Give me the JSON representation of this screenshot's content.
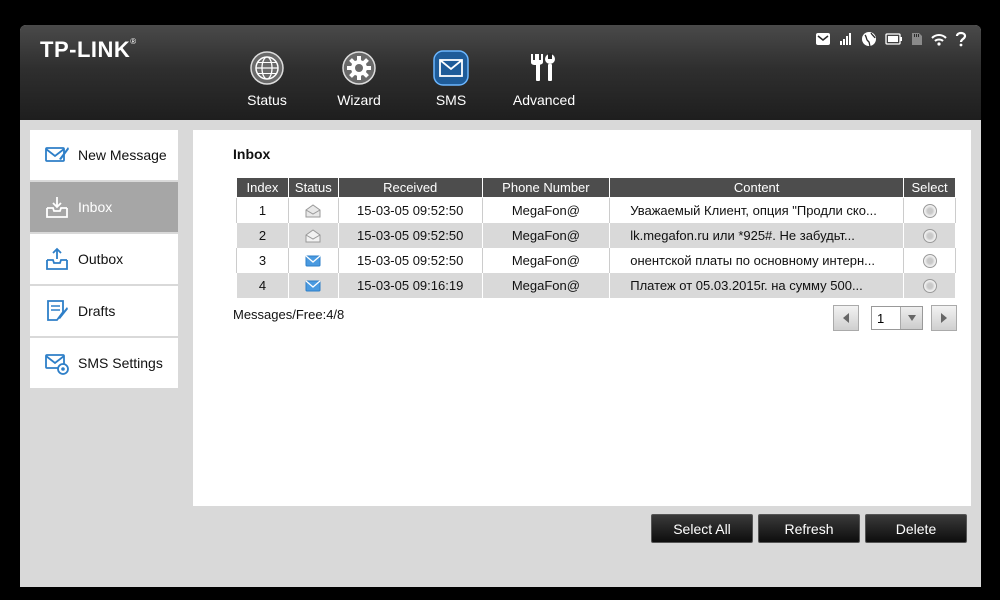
{
  "brand": {
    "logo_text": "TP-LINK",
    "logo_mark": "®"
  },
  "nav": [
    {
      "label": "Status",
      "icon": "globe-icon"
    },
    {
      "label": "Wizard",
      "icon": "gear-icon"
    },
    {
      "label": "SMS",
      "icon": "envelope-icon",
      "active": true
    },
    {
      "label": "Advanced",
      "icon": "tools-icon"
    }
  ],
  "status_bar": [
    "sms-icon",
    "signal-icon",
    "internet-icon",
    "battery-icon",
    "sd-card-icon",
    "wifi-icon",
    "help-icon"
  ],
  "sidebar": {
    "items": [
      {
        "label": "New Message",
        "icon": "new-message-icon"
      },
      {
        "label": "Inbox",
        "icon": "inbox-icon",
        "active": true
      },
      {
        "label": "Outbox",
        "icon": "outbox-icon"
      },
      {
        "label": "Drafts",
        "icon": "drafts-icon"
      },
      {
        "label": "SMS Settings",
        "icon": "sms-settings-icon"
      }
    ]
  },
  "inbox": {
    "title": "Inbox",
    "columns": [
      "Index",
      "Status",
      "Received",
      "Phone Number",
      "Content",
      "Select"
    ],
    "rows": [
      {
        "index": "1",
        "status": "read",
        "received": "15-03-05 09:52:50",
        "phone": "MegaFon@",
        "content": "Уважаемый Клиент, опция \"Продли ско..."
      },
      {
        "index": "2",
        "status": "read",
        "received": "15-03-05 09:52:50",
        "phone": "MegaFon@",
        "content": "lk.megafon.ru или *925#. Не забудьт..."
      },
      {
        "index": "3",
        "status": "unread",
        "received": "15-03-05 09:52:50",
        "phone": "MegaFon@",
        "content": "онентской платы по основному интерн..."
      },
      {
        "index": "4",
        "status": "unread",
        "received": "15-03-05 09:16:19",
        "phone": "MegaFon@",
        "content": "Платеж от 05.03.2015г. на сумму 500..."
      }
    ],
    "message_count": "Messages/Free:4/8",
    "page": "1"
  },
  "actions": {
    "select_all": "Select All",
    "refresh": "Refresh",
    "delete": "Delete"
  },
  "colors": {
    "topbar": "#2f2f2f",
    "accent_blue": "#3d8fd6",
    "sidebar_active": "#a6a6a6",
    "table_header": "#4d4d4d"
  }
}
